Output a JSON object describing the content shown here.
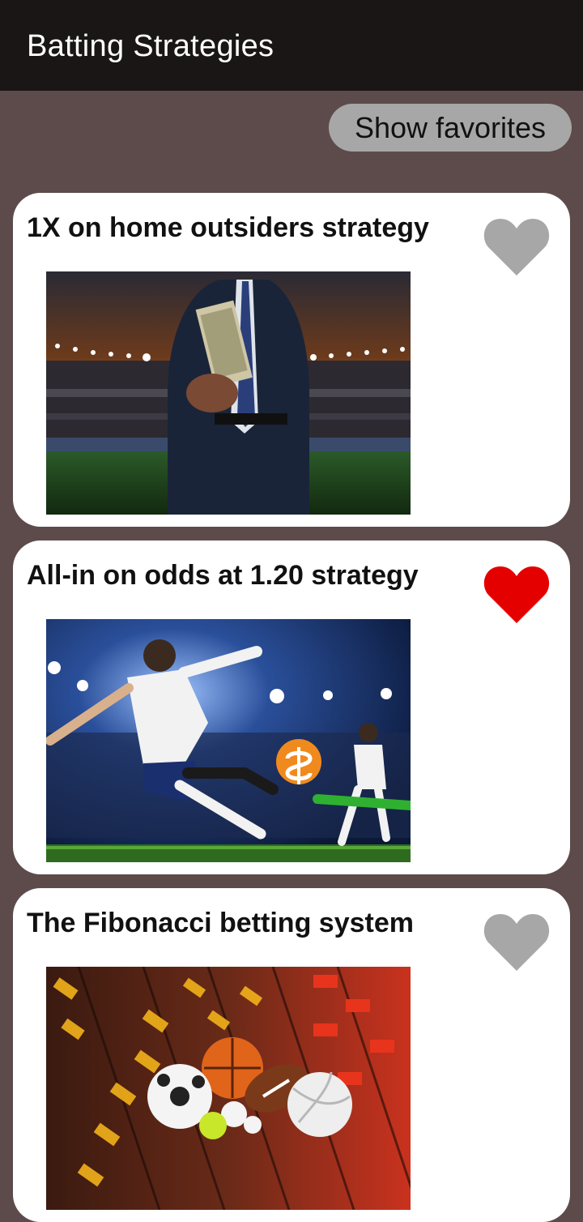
{
  "app_bar": {
    "title": "Batting Strategies"
  },
  "toolbar": {
    "show_favorites_label": "Show favorites"
  },
  "colors": {
    "app_bar_bg": "#1b1616",
    "page_bg": "#5d4b4b",
    "favorite_active": "#e50000",
    "favorite_inactive": "#a7a7a7"
  },
  "cards": [
    {
      "title": "1X on home outsiders strategy",
      "favorite": false,
      "image": "businessman-holding-money-in-stadium"
    },
    {
      "title": "All-in on odds at 1.20 strategy",
      "favorite": true,
      "image": "football-players-kicking-with-dollar-coin"
    },
    {
      "title": "The Fibonacci betting system",
      "favorite": false,
      "image": "sports-balls-over-betting-odds-board"
    }
  ]
}
